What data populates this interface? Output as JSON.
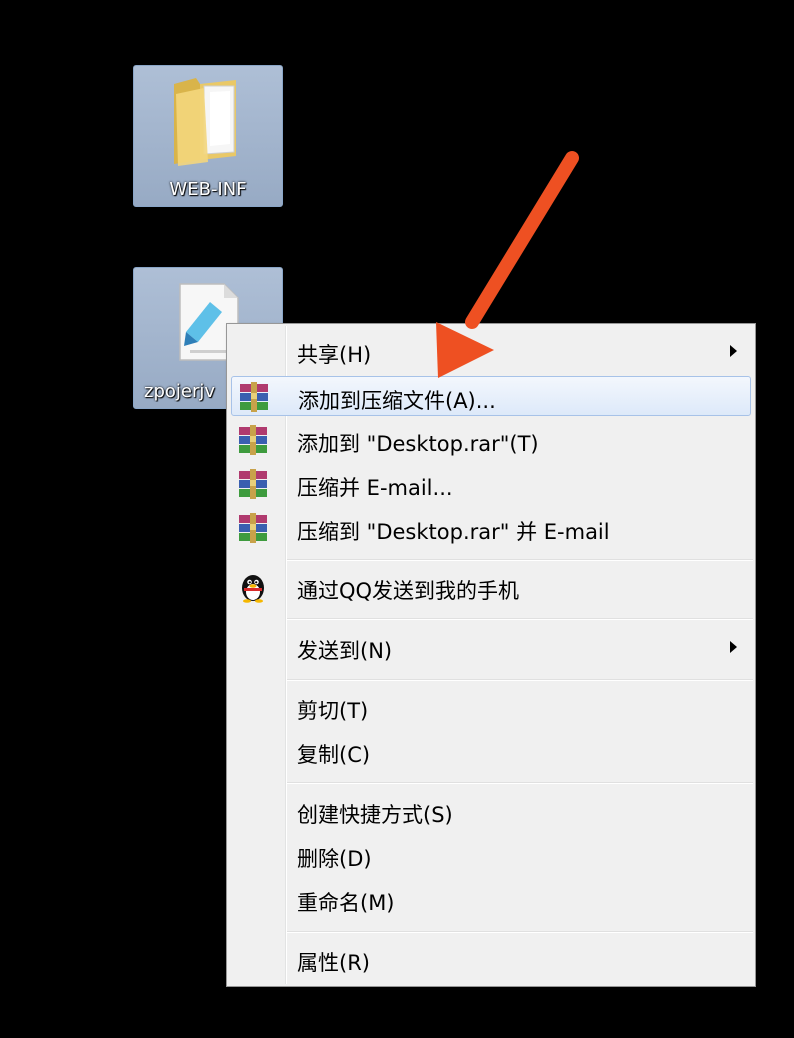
{
  "desktop": {
    "icons": [
      {
        "label": "WEB-INF",
        "type": "folder"
      },
      {
        "label": "zpojerjv",
        "type": "file"
      }
    ]
  },
  "context_menu": {
    "items": [
      {
        "label": "共享(H)",
        "icon": "",
        "submenu": true,
        "highlighted": false
      },
      {
        "label": "添加到压缩文件(A)...",
        "icon": "winrar-icon",
        "submenu": false,
        "highlighted": true
      },
      {
        "label": "添加到 \"Desktop.rar\"(T)",
        "icon": "winrar-icon",
        "submenu": false,
        "highlighted": false
      },
      {
        "label": "压缩并 E-mail...",
        "icon": "winrar-icon",
        "submenu": false,
        "highlighted": false
      },
      {
        "label": "压缩到 \"Desktop.rar\" 并 E-mail",
        "icon": "winrar-icon",
        "submenu": false,
        "highlighted": false
      },
      {
        "label": "通过QQ发送到我的手机",
        "icon": "qq-penguin-icon",
        "submenu": false,
        "highlighted": false
      },
      {
        "label": "发送到(N)",
        "icon": "",
        "submenu": true,
        "highlighted": false
      },
      {
        "label": "剪切(T)",
        "icon": "",
        "submenu": false,
        "highlighted": false
      },
      {
        "label": "复制(C)",
        "icon": "",
        "submenu": false,
        "highlighted": false
      },
      {
        "label": "创建快捷方式(S)",
        "icon": "",
        "submenu": false,
        "highlighted": false
      },
      {
        "label": "删除(D)",
        "icon": "",
        "submenu": false,
        "highlighted": false
      },
      {
        "label": "重命名(M)",
        "icon": "",
        "submenu": false,
        "highlighted": false
      },
      {
        "label": "属性(R)",
        "icon": "",
        "submenu": false,
        "highlighted": false
      }
    ]
  },
  "colors": {
    "annotation_arrow": "#ee5022",
    "menu_background": "#f0f0f0",
    "highlight_border": "#a7c2e8"
  }
}
